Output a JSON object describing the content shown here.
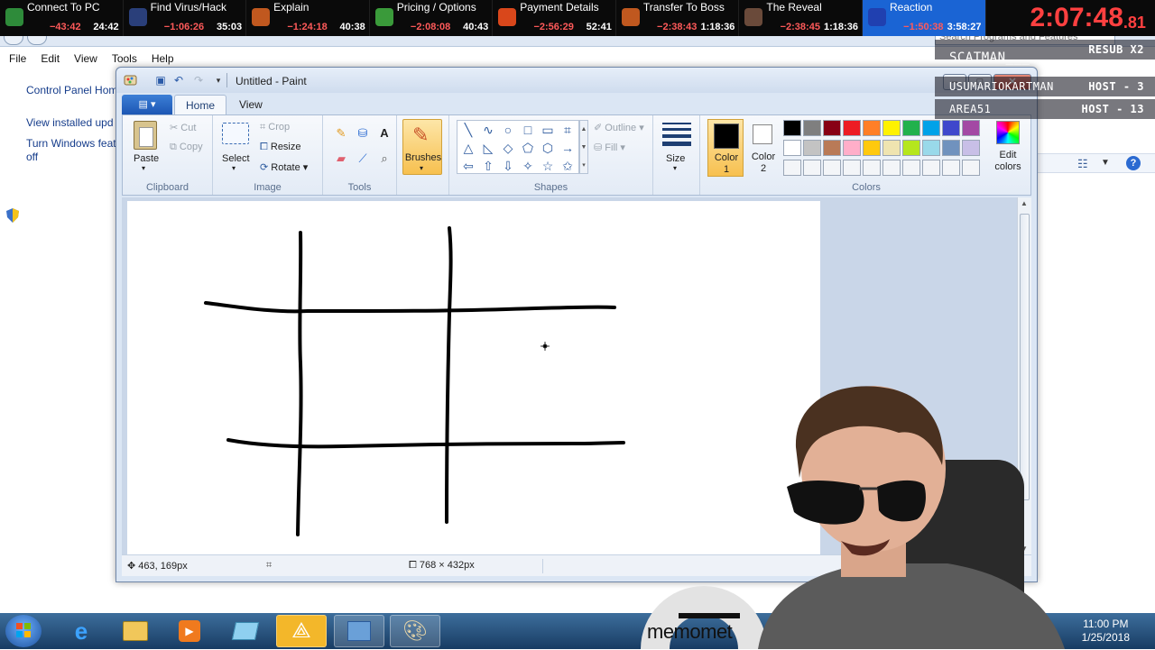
{
  "splits": [
    {
      "name": "Connect To PC",
      "delta": "−43:42",
      "time": "24:42",
      "icon": "shield-icon",
      "icon_color": "#2e8b3a"
    },
    {
      "name": "Find Virus/Hack",
      "delta": "−1:06:26",
      "time": "35:03",
      "icon": "virus-face-icon",
      "icon_color": "#2a3f7a"
    },
    {
      "name": "Explain",
      "delta": "−1:24:18",
      "time": "40:38",
      "icon": "card-icon",
      "icon_color": "#c0581f"
    },
    {
      "name": "Pricing / Options",
      "delta": "−2:08:08",
      "time": "40:43",
      "icon": "money-hand-icon",
      "icon_color": "#3a9a3a"
    },
    {
      "name": "Payment Details",
      "delta": "−2:56:29",
      "time": "52:41",
      "icon": "fire-icon",
      "icon_color": "#d9471b"
    },
    {
      "name": "Transfer To Boss",
      "delta": "−2:38:43",
      "time": "1:18:36",
      "icon": "card-icon",
      "icon_color": "#c0581f"
    },
    {
      "name": "The Reveal",
      "delta": "−2:38:45",
      "time": "1:18:36",
      "icon": "face-icon",
      "icon_color": "#6a4a3a"
    },
    {
      "name": "Reaction",
      "delta": "−1:50:38",
      "time": "3:58:27",
      "icon": "blue-face-icon",
      "icon_color": "#2040b0",
      "current": true
    }
  ],
  "main_timer": {
    "main": "2:07:48",
    "fraction": ".81"
  },
  "overlay": {
    "rows": [
      {
        "user": "",
        "value": "RESUB X2"
      },
      {
        "user": "SCATMAN___",
        "value": ""
      },
      {
        "user": "USUMARIOKARTMAN",
        "value": "HOST - 3"
      },
      {
        "user": "AREA51",
        "value": "HOST - 13"
      }
    ]
  },
  "control_panel": {
    "search_placeholder": "Search Programs and Features",
    "menu": [
      "File",
      "Edit",
      "View",
      "Tools",
      "Help"
    ],
    "links": [
      "Control Panel Hom",
      "View installed upd",
      "Turn Windows feat",
      "off"
    ]
  },
  "paint": {
    "title": "Untitled - Paint",
    "tabs": {
      "file": "▤ ▾",
      "home": "Home",
      "view": "View"
    },
    "clipboard": {
      "paste": "Paste",
      "cut": "Cut",
      "copy": "Copy",
      "label": "Clipboard"
    },
    "image": {
      "select": "Select",
      "crop": "Crop",
      "resize": "Resize",
      "rotate": "Rotate",
      "label": "Image"
    },
    "tools": {
      "label": "Tools"
    },
    "brushes": {
      "label": "Brushes"
    },
    "shapes": {
      "outline": "Outline",
      "fill": "Fill",
      "label": "Shapes"
    },
    "size": {
      "label": "Size"
    },
    "colors": {
      "color1": "Color",
      "color1_num": "1",
      "color2": "Color",
      "color2_num": "2",
      "edit": "Edit colors",
      "label": "Colors",
      "palette_row1": [
        "#000000",
        "#7f7f7f",
        "#880015",
        "#ed1c24",
        "#ff7f27",
        "#fff200",
        "#22b14c",
        "#00a2e8",
        "#3f48cc",
        "#a349a4"
      ],
      "palette_row2": [
        "#ffffff",
        "#c3c3c3",
        "#b97a57",
        "#ffaec9",
        "#ffc90e",
        "#efe4b0",
        "#b5e61d",
        "#99d9ea",
        "#7092be",
        "#c8bfe7"
      ]
    },
    "status": {
      "cursor": "463, 169px",
      "dimensions": "768 × 432px"
    }
  },
  "taskbar": {
    "time": "11:00 PM",
    "date": "1/25/2018"
  },
  "watermark": "memomet"
}
